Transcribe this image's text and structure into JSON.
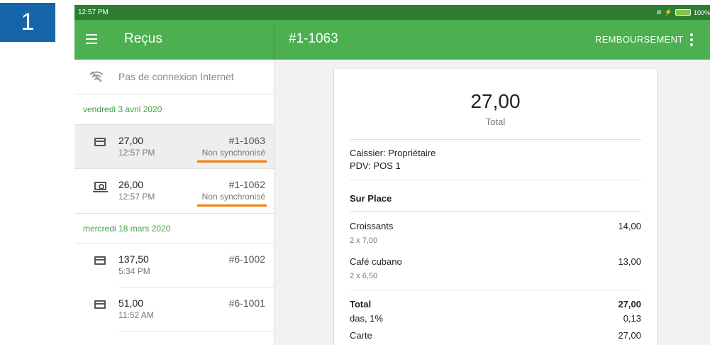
{
  "step": "1",
  "status_bar": {
    "time": "12:57 PM",
    "battery": "100%"
  },
  "appbar": {
    "title": "Reçus",
    "receipt_number": "#1-1063",
    "refund_label": "REMBOURSEMENT"
  },
  "list": {
    "offline_text": "Pas de connexion Internet",
    "groups": [
      {
        "date": "vendredi 3 avril 2020",
        "items": [
          {
            "amount": "27,00",
            "time": "12:57 PM",
            "number": "#1-1063",
            "sync": "Non synchronisé",
            "icon": "card-icon"
          },
          {
            "amount": "26,00",
            "time": "12:57 PM",
            "number": "#1-1062",
            "sync": "Non synchronisé",
            "icon": "cash-icon"
          }
        ]
      },
      {
        "date": "mercredi 18 mars 2020",
        "items": [
          {
            "amount": "137,50",
            "time": "5:34 PM",
            "number": "#6-1002",
            "icon": "card-icon"
          },
          {
            "amount": "51,00",
            "time": "11:52 AM",
            "number": "#6-1001",
            "icon": "card-icon"
          }
        ]
      }
    ]
  },
  "receipt": {
    "total_amount": "27,00",
    "total_label": "Total",
    "cashier": "Caissier: Propriétaire",
    "pos": "PDV: POS 1",
    "dining_option": "Sur Place",
    "items": [
      {
        "name": "Croissants",
        "qty": "2 x 7,00",
        "price": "14,00"
      },
      {
        "name": "Café cubano",
        "qty": "2 x 6,50",
        "price": "13,00"
      }
    ],
    "total_row": {
      "label": "Total",
      "value": "27,00"
    },
    "tax_row": {
      "label": "das, 1%",
      "value": "0,13"
    },
    "payment_row": {
      "label": "Carte",
      "value": "27,00"
    }
  },
  "colors": {
    "appbar": "#4caf50",
    "statusbar": "#2e7d32",
    "accent_date": "#43a047",
    "underline": "#f57c00",
    "badge": "#1565a8"
  }
}
